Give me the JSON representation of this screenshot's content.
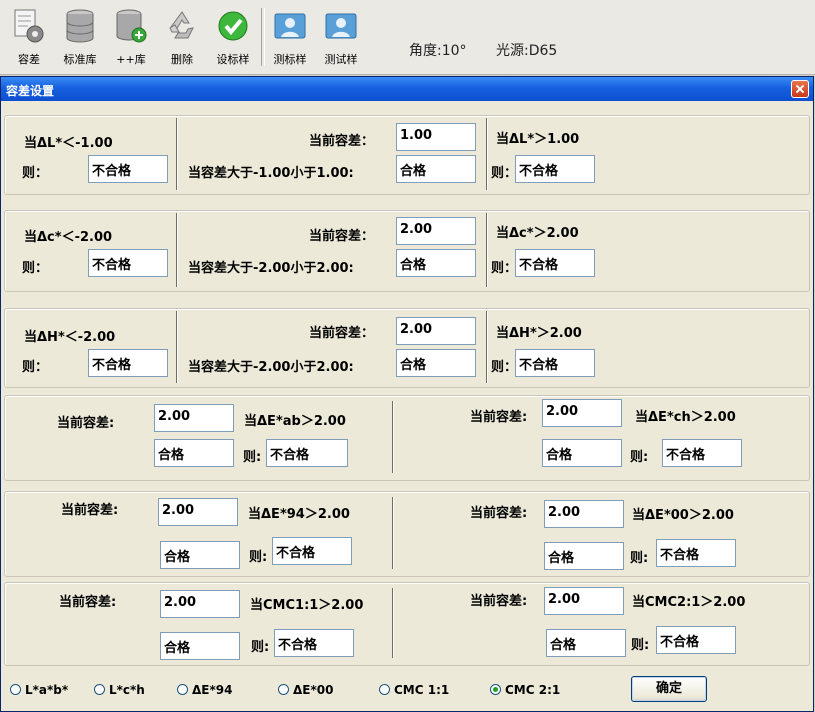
{
  "toolbar": {
    "items": [
      "容差",
      "标准库",
      "++库",
      "删除",
      "设标样",
      "测标样",
      "测试样"
    ],
    "angle": "角度:10°",
    "light": "光源:D65"
  },
  "dialog": {
    "title": "容差设置"
  },
  "rows": [
    {
      "left_cond": "当ΔL*＜-1.00",
      "then": "则：",
      "left_result": "不合格",
      "cur_label": "当前容差：",
      "cur_value": "1.00",
      "range_label": "当容差大于-1.00小于1.00:",
      "range_result": "合格",
      "right_cond": "当ΔL*＞1.00",
      "right_result": "不合格"
    },
    {
      "left_cond": "当Δc*＜-2.00",
      "then": "则：",
      "left_result": "不合格",
      "cur_label": "当前容差：",
      "cur_value": "2.00",
      "range_label": "当容差大于-2.00小于2.00:",
      "range_result": "合格",
      "right_cond": "当Δc*＞2.00",
      "right_result": "不合格"
    },
    {
      "left_cond": "当ΔH*＜-2.00",
      "then": "则：",
      "left_result": "不合格",
      "cur_label": "当前容差：",
      "cur_value": "2.00",
      "range_label": "当容差大于-2.00小于2.00:",
      "range_result": "合格",
      "right_cond": "当ΔH*＞2.00",
      "right_result": "不合格"
    }
  ],
  "pairs": [
    {
      "left": {
        "cur_label": "当前容差:",
        "value": "2.00",
        "cond": "当ΔE*ab＞2.00",
        "pass": "合格",
        "then": "则:",
        "fail": "不合格"
      },
      "right": {
        "cur_label": "当前容差:",
        "value": "2.00",
        "cond": "当ΔE*ch＞2.00",
        "pass": "合格",
        "then": "则:",
        "fail": "不合格"
      }
    },
    {
      "left": {
        "cur_label": "当前容差:",
        "value": "2.00",
        "cond": "当ΔE*94＞2.00",
        "pass": "合格",
        "then": "则:",
        "fail": "不合格"
      },
      "right": {
        "cur_label": "当前容差:",
        "value": "2.00",
        "cond": "当ΔE*00＞2.00",
        "pass": "合格",
        "then": "则:",
        "fail": "不合格"
      }
    },
    {
      "left": {
        "cur_label": "当前容差:",
        "value": "2.00",
        "cond": "当CMC1:1＞2.00",
        "pass": "合格",
        "then": "则:",
        "fail": "不合格"
      },
      "right": {
        "cur_label": "当前容差:",
        "value": "2.00",
        "cond": "当CMC2:1＞2.00",
        "pass": "合格",
        "then": "则:",
        "fail": "不合格"
      }
    }
  ],
  "radios": [
    {
      "label": "L*a*b*",
      "selected": false
    },
    {
      "label": "L*c*h",
      "selected": false
    },
    {
      "label": "ΔE*94",
      "selected": false
    },
    {
      "label": "ΔE*00",
      "selected": false
    },
    {
      "label": "CMC 1:1",
      "selected": false
    },
    {
      "label": "CMC 2:1",
      "selected": true
    }
  ],
  "ok_label": "确定",
  "colors": {
    "titlebar": "#0c4fd0",
    "dialog_bg": "#ece9d8",
    "close": "#c4381a",
    "radio_dot": "#21a121"
  }
}
